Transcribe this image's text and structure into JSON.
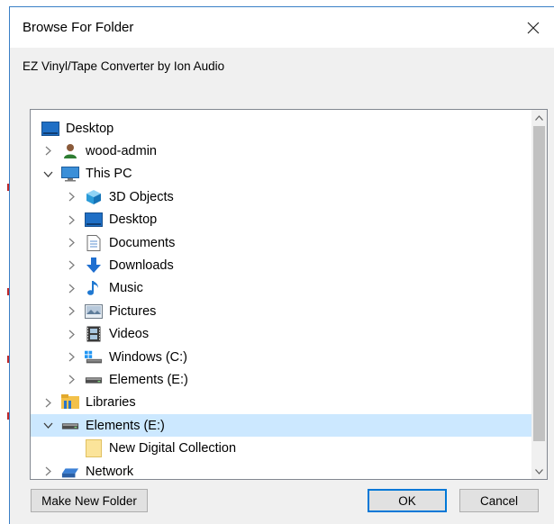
{
  "window": {
    "title": "Browse For Folder"
  },
  "dialog": {
    "description": "EZ Vinyl/Tape Converter by Ion Audio"
  },
  "tree": {
    "items": [
      {
        "label": "Desktop",
        "icon": "desktop-icon",
        "level": 0,
        "expander": "none"
      },
      {
        "label": "wood-admin",
        "icon": "user-icon",
        "level": 0,
        "expander": "collapsed"
      },
      {
        "label": "This PC",
        "icon": "computer-icon",
        "level": 0,
        "expander": "expanded"
      },
      {
        "label": "3D Objects",
        "icon": "3d-objects-icon",
        "level": 1,
        "expander": "collapsed"
      },
      {
        "label": "Desktop",
        "icon": "desktop-icon",
        "level": 1,
        "expander": "collapsed"
      },
      {
        "label": "Documents",
        "icon": "documents-icon",
        "level": 1,
        "expander": "collapsed"
      },
      {
        "label": "Downloads",
        "icon": "downloads-icon",
        "level": 1,
        "expander": "collapsed"
      },
      {
        "label": "Music",
        "icon": "music-icon",
        "level": 1,
        "expander": "collapsed"
      },
      {
        "label": "Pictures",
        "icon": "pictures-icon",
        "level": 1,
        "expander": "collapsed"
      },
      {
        "label": "Videos",
        "icon": "videos-icon",
        "level": 1,
        "expander": "collapsed"
      },
      {
        "label": "Windows (C:)",
        "icon": "windows-drive-icon",
        "level": 1,
        "expander": "collapsed"
      },
      {
        "label": "Elements (E:)",
        "icon": "drive-icon",
        "level": 1,
        "expander": "collapsed"
      },
      {
        "label": "Libraries",
        "icon": "libraries-icon",
        "level": 0,
        "expander": "collapsed"
      },
      {
        "label": "Elements (E:)",
        "icon": "drive-icon",
        "level": 0,
        "expander": "expanded",
        "selected": true
      },
      {
        "label": "New Digital Collection",
        "icon": "folder-icon",
        "level": 1,
        "expander": "none"
      },
      {
        "label": "Network",
        "icon": "network-icon",
        "level": 0,
        "expander": "collapsed"
      }
    ]
  },
  "buttons": {
    "make_new_folder": "Make New Folder",
    "ok": "OK",
    "cancel": "Cancel"
  },
  "colors": {
    "selection": "#cce8ff",
    "accent": "#0078d7",
    "border": "#3a7fc6"
  }
}
